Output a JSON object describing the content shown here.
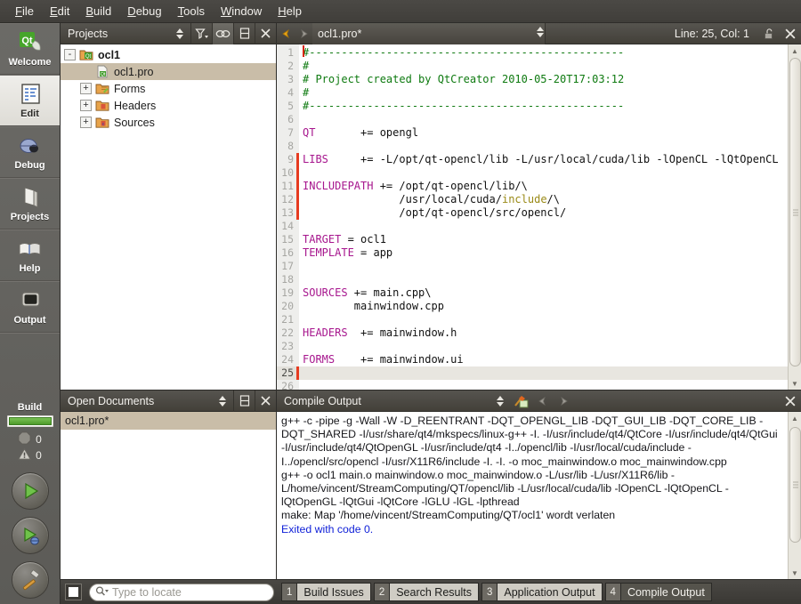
{
  "menu": {
    "items": [
      {
        "label": "File",
        "mnemonic": "F"
      },
      {
        "label": "Edit",
        "mnemonic": "E"
      },
      {
        "label": "Build",
        "mnemonic": "B"
      },
      {
        "label": "Debug",
        "mnemonic": "D"
      },
      {
        "label": "Tools",
        "mnemonic": "T"
      },
      {
        "label": "Window",
        "mnemonic": "W"
      },
      {
        "label": "Help",
        "mnemonic": "H"
      }
    ]
  },
  "modebar": {
    "modes": [
      {
        "label": "Welcome",
        "icon": "qt-logo-icon",
        "active": false
      },
      {
        "label": "Edit",
        "icon": "edit-document-icon",
        "active": true
      },
      {
        "label": "Debug",
        "icon": "bug-icon",
        "active": false
      },
      {
        "label": "Projects",
        "icon": "book-closed-icon",
        "active": false
      },
      {
        "label": "Help",
        "icon": "book-open-icon",
        "active": false
      },
      {
        "label": "Output",
        "icon": "monitor-icon",
        "active": false
      }
    ],
    "build": {
      "title": "Build",
      "progress_percent": 100,
      "error_count": "0",
      "warning_count": "0",
      "error_icon": "octagon-error-icon",
      "warning_icon": "triangle-warning-icon",
      "buttons": [
        {
          "name": "run-button",
          "icon": "play-green-icon"
        },
        {
          "name": "debug-button",
          "icon": "play-with-bug-icon"
        },
        {
          "name": "build-button",
          "icon": "hammer-icon"
        }
      ]
    }
  },
  "projects": {
    "title": "Projects",
    "toolbar": [
      {
        "name": "filter-button",
        "icon": "funnel-filter-icon"
      },
      {
        "name": "sync-with-editor-button",
        "icon": "link-chain-icon",
        "active": true
      },
      {
        "name": "split-button",
        "icon": "split-pane-icon"
      },
      {
        "name": "close-button",
        "icon": "close-x-icon"
      }
    ],
    "tree": [
      {
        "label": "ocl1",
        "indent": 0,
        "expander": "-",
        "icon": "qt-project-icon",
        "bold": true,
        "selected": false
      },
      {
        "label": "ocl1.pro",
        "indent": 1,
        "expander": "",
        "icon": "pro-file-icon",
        "bold": false,
        "selected": true
      },
      {
        "label": "Forms",
        "indent": 1,
        "expander": "+",
        "icon": "folder-forms-icon",
        "bold": false,
        "selected": false
      },
      {
        "label": "Headers",
        "indent": 1,
        "expander": "+",
        "icon": "folder-headers-icon",
        "bold": false,
        "selected": false
      },
      {
        "label": "Sources",
        "indent": 1,
        "expander": "+",
        "icon": "folder-sources-icon",
        "bold": false,
        "selected": false
      }
    ]
  },
  "open_documents": {
    "title": "Open Documents",
    "toolbar": [
      {
        "name": "split-button",
        "icon": "split-pane-icon"
      },
      {
        "name": "close-button",
        "icon": "close-x-icon"
      }
    ],
    "documents": [
      {
        "label": "ocl1.pro*",
        "selected": true
      }
    ]
  },
  "editor": {
    "filename": "ocl1.pro*",
    "position": "Line: 25, Col: 1",
    "back_icon": "arrow-back-icon",
    "forward_icon": "arrow-forward-icon",
    "lock_icon": "padlock-open-icon",
    "close_icon": "close-x-icon",
    "current_line": 25,
    "lines": [
      {
        "n": 1,
        "modified": false,
        "tokens": [
          {
            "t": "#-------------------------------------------------",
            "c": "cmt"
          }
        ]
      },
      {
        "n": 2,
        "modified": false,
        "tokens": [
          {
            "t": "#",
            "c": "cmt"
          }
        ]
      },
      {
        "n": 3,
        "modified": false,
        "tokens": [
          {
            "t": "# Project created by QtCreator 2010-05-20T17:03:12",
            "c": "cmt"
          }
        ]
      },
      {
        "n": 4,
        "modified": false,
        "tokens": [
          {
            "t": "#",
            "c": "cmt"
          }
        ]
      },
      {
        "n": 5,
        "modified": false,
        "tokens": [
          {
            "t": "#-------------------------------------------------",
            "c": "cmt"
          }
        ]
      },
      {
        "n": 6,
        "modified": false,
        "tokens": []
      },
      {
        "n": 7,
        "modified": false,
        "tokens": [
          {
            "t": "QT",
            "c": "kw"
          },
          {
            "t": "       += opengl",
            "c": ""
          }
        ]
      },
      {
        "n": 8,
        "modified": false,
        "tokens": []
      },
      {
        "n": 9,
        "modified": true,
        "tokens": [
          {
            "t": "LIBS",
            "c": "kw"
          },
          {
            "t": "     += -L/opt/qt-opencl/lib -L/usr/local/cuda/lib -lOpenCL -lQtOpenCL",
            "c": ""
          }
        ]
      },
      {
        "n": 10,
        "modified": true,
        "tokens": []
      },
      {
        "n": 11,
        "modified": true,
        "tokens": [
          {
            "t": "INCLUDEPATH",
            "c": "kw"
          },
          {
            "t": " += /opt/qt-opencl/lib/\\",
            "c": ""
          }
        ]
      },
      {
        "n": 12,
        "modified": true,
        "tokens": [
          {
            "t": "               /usr/local/cuda/",
            "c": ""
          },
          {
            "t": "include",
            "c": "kw2"
          },
          {
            "t": "/\\",
            "c": ""
          }
        ]
      },
      {
        "n": 13,
        "modified": true,
        "tokens": [
          {
            "t": "               /opt/qt-opencl/src/opencl/",
            "c": ""
          }
        ]
      },
      {
        "n": 14,
        "modified": false,
        "tokens": []
      },
      {
        "n": 15,
        "modified": false,
        "tokens": [
          {
            "t": "TARGET",
            "c": "kw"
          },
          {
            "t": " = ocl1",
            "c": ""
          }
        ]
      },
      {
        "n": 16,
        "modified": false,
        "tokens": [
          {
            "t": "TEMPLATE",
            "c": "kw"
          },
          {
            "t": " = app",
            "c": ""
          }
        ]
      },
      {
        "n": 17,
        "modified": false,
        "tokens": []
      },
      {
        "n": 18,
        "modified": false,
        "tokens": []
      },
      {
        "n": 19,
        "modified": false,
        "tokens": [
          {
            "t": "SOURCES",
            "c": "kw"
          },
          {
            "t": " += main.cpp\\",
            "c": ""
          }
        ]
      },
      {
        "n": 20,
        "modified": false,
        "tokens": [
          {
            "t": "        mainwindow.cpp",
            "c": ""
          }
        ]
      },
      {
        "n": 21,
        "modified": false,
        "tokens": []
      },
      {
        "n": 22,
        "modified": false,
        "tokens": [
          {
            "t": "HEADERS",
            "c": "kw"
          },
          {
            "t": "  += mainwindow.h",
            "c": ""
          }
        ]
      },
      {
        "n": 23,
        "modified": false,
        "tokens": []
      },
      {
        "n": 24,
        "modified": false,
        "tokens": [
          {
            "t": "FORMS",
            "c": "kw"
          },
          {
            "t": "    += mainwindow.ui",
            "c": ""
          }
        ]
      },
      {
        "n": 25,
        "modified": true,
        "tokens": []
      },
      {
        "n": 26,
        "modified": false,
        "tokens": []
      }
    ]
  },
  "compile_output": {
    "title": "Compile Output",
    "toolbar": [
      {
        "name": "clear-button",
        "icon": "broom-clear-icon"
      },
      {
        "name": "previous-item-button",
        "icon": "arrow-back-icon"
      },
      {
        "name": "next-item-button",
        "icon": "arrow-forward-icon"
      },
      {
        "name": "close-button",
        "icon": "close-x-icon"
      }
    ],
    "lines": [
      {
        "text": "g++ -c -pipe -g -Wall -W -D_REENTRANT -DQT_OPENGL_LIB -DQT_GUI_LIB -DQT_CORE_LIB -DQT_SHARED -I/usr/share/qt4/mkspecs/linux-g++ -I. -I/usr/include/qt4/QtCore -I/usr/include/qt4/QtGui -I/usr/include/qt4/QtOpenGL -I/usr/include/qt4 -I../opencl/lib -I/usr/local/cuda/include -I../opencl/src/opencl -I/usr/X11R6/include -I. -I. -o moc_mainwindow.o moc_mainwindow.cpp",
        "style": "normal"
      },
      {
        "text": "g++ -o ocl1 main.o mainwindow.o moc_mainwindow.o -L/usr/lib -L/usr/X11R6/lib -L/home/vincent/StreamComputing/QT/opencl/lib -L/usr/local/cuda/lib -lOpenCL -lQtOpenCL -lQtOpenGL -lQtGui -lQtCore -lGLU -lGL -lpthread",
        "style": "normal"
      },
      {
        "text": "make: Map '/home/vincent/StreamComputing/QT/ocl1' wordt verlaten",
        "style": "normal"
      },
      {
        "text": "Exited with code 0.",
        "style": "exit"
      }
    ]
  },
  "statusbar": {
    "locator_placeholder": "Type to locate",
    "search_icon": "magnifier-icon",
    "toggle_sidebar_icon": "toggle-sidebar-icon",
    "tabs": [
      {
        "num": "1",
        "label": "Build Issues",
        "active": false
      },
      {
        "num": "2",
        "label": "Search Results",
        "active": false
      },
      {
        "num": "3",
        "label": "Application Output",
        "active": false
      },
      {
        "num": "4",
        "label": "Compile Output",
        "active": true
      }
    ]
  }
}
